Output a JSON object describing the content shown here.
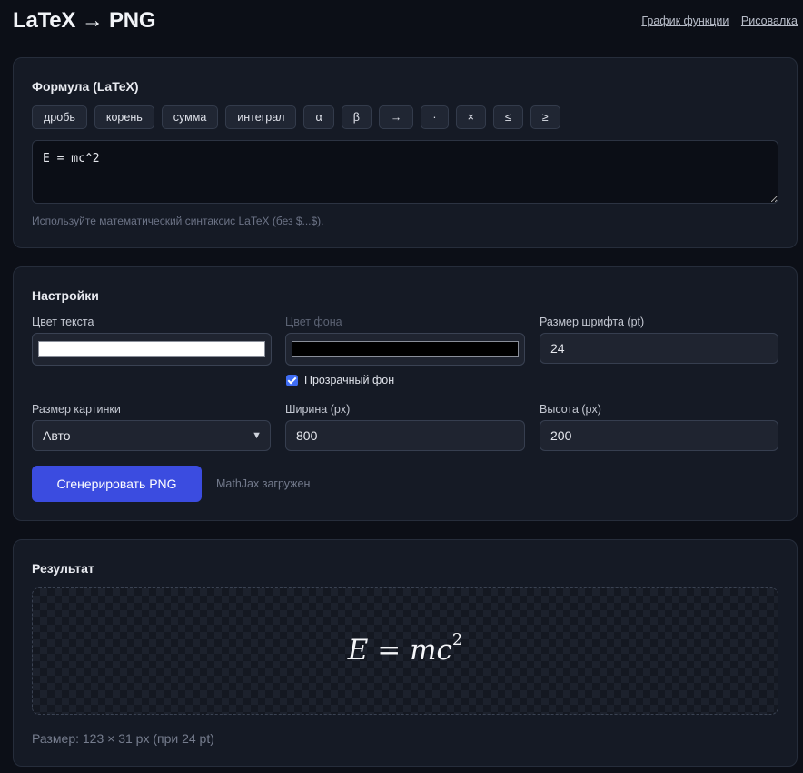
{
  "header": {
    "title": "LaTeX → PNG",
    "links": [
      "График функции",
      "Рисовалка"
    ]
  },
  "formula_card": {
    "title": "Формула (LaTeX)",
    "chips": [
      "дробь",
      "корень",
      "сумма",
      "интеграл",
      "α",
      "β",
      "→",
      "·",
      "×",
      "≤",
      "≥"
    ],
    "value": "E = mc^2",
    "hint": "Используйте математический синтаксис LaTeX (без $...$)."
  },
  "settings": {
    "title": "Настройки",
    "text_color_label": "Цвет текста",
    "text_color": "#ffffff",
    "bg_color_label": "Цвет фона",
    "bg_color": "#000000",
    "font_size_label": "Размер шрифта (pt)",
    "font_size": "24",
    "transparent_label": "Прозрачный фон",
    "image_size_label": "Размер картинки",
    "image_size_value": "Авто",
    "width_label": "Ширина (px)",
    "width_value": "800",
    "height_label": "Высота (px)",
    "height_value": "200",
    "generate_label": "Сгенерировать PNG",
    "status": "MathJax загружен"
  },
  "result": {
    "title": "Результат",
    "formula_lhs": "E",
    "formula_eq": "=",
    "formula_base": "mc",
    "formula_exp": "2",
    "size_info": "Размер: 123 × 31 px (при 24 pt)"
  },
  "colors": {
    "accent": "#3b4ce0",
    "checkbox": "#3f6df4",
    "background": "#0c0f17",
    "card": "#151a25"
  }
}
